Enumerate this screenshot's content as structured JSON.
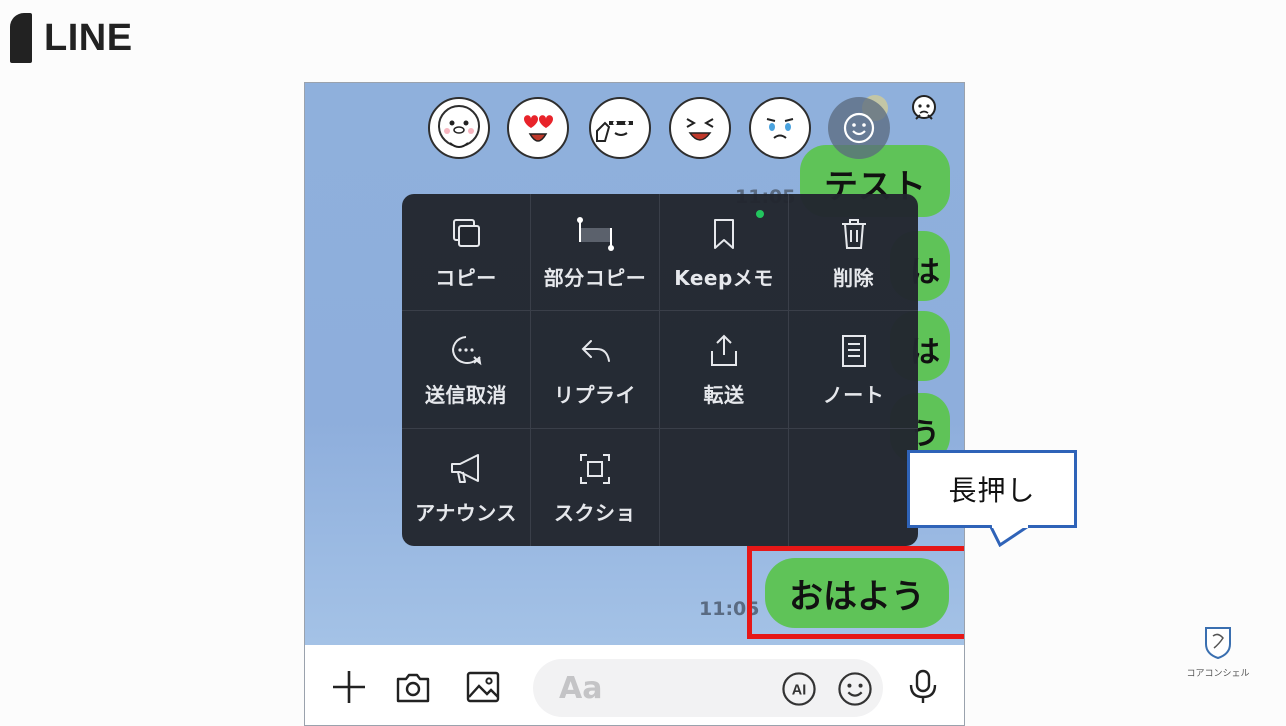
{
  "brand": {
    "name": "LINE"
  },
  "chat": {
    "bubble_top": "テスト",
    "bubble_partial": [
      "は",
      "は",
      "う"
    ],
    "timestamp_top": "11:05",
    "highlighted_message": "おはよう",
    "timestamp_bottom": "11:05"
  },
  "reactions": [
    "line-sticker-shy",
    "line-sticker-love",
    "line-sticker-thumbs-up",
    "line-sticker-laugh",
    "line-sticker-cry"
  ],
  "context_menu": {
    "items": [
      {
        "label": "コピー",
        "icon": "copy-icon"
      },
      {
        "label": "部分コピー",
        "icon": "partial-copy-icon"
      },
      {
        "label": "Keepメモ",
        "icon": "bookmark-icon"
      },
      {
        "label": "削除",
        "icon": "trash-icon"
      },
      {
        "label": "送信取消",
        "icon": "unsend-icon"
      },
      {
        "label": "リプライ",
        "icon": "reply-icon"
      },
      {
        "label": "転送",
        "icon": "share-icon"
      },
      {
        "label": "ノート",
        "icon": "note-icon"
      },
      {
        "label": "アナウンス",
        "icon": "megaphone-icon"
      },
      {
        "label": "スクショ",
        "icon": "screenshot-icon"
      }
    ]
  },
  "composer": {
    "placeholder": "Aa",
    "ai_label": "AI"
  },
  "callout": {
    "text": "長押し"
  },
  "watermark": {
    "text": "コアコンシェル"
  },
  "colors": {
    "bubble_green": "#5fc358",
    "chat_bg": "#8fb0dc",
    "menu_bg": "#22262e",
    "highlight_red": "#e61717",
    "callout_border": "#2f63b8",
    "new_dot": "#22c55e"
  }
}
